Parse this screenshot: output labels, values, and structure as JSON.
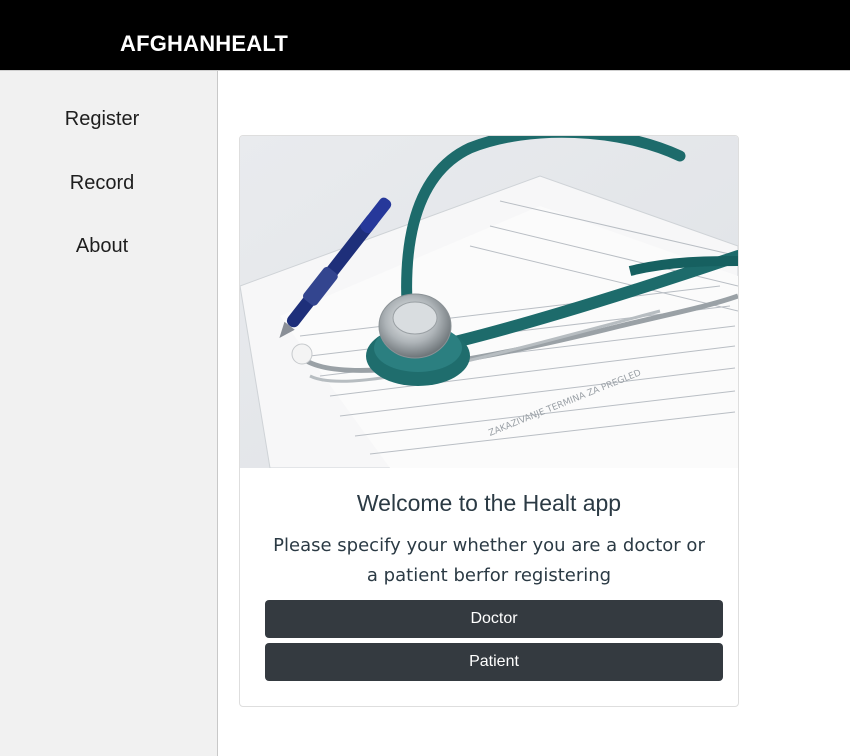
{
  "app": {
    "brand": "AFGHANHEALT"
  },
  "sidebar": {
    "items": [
      {
        "label": "Register"
      },
      {
        "label": "Record"
      },
      {
        "label": "About"
      }
    ]
  },
  "card": {
    "image_subject": "stethoscope-pen-medical-form",
    "title": "Welcome to the Healt app",
    "text": "Please specify your whether you are a doctor or a patient berfor registering",
    "buttons": [
      {
        "label": "Doctor"
      },
      {
        "label": "Patient"
      }
    ]
  },
  "colors": {
    "topbar": "#000000",
    "sidebar": "#f1f1f1",
    "button": "#343a40",
    "stethoscope": "#1d6b6b",
    "pen": "#1e2f7a"
  }
}
